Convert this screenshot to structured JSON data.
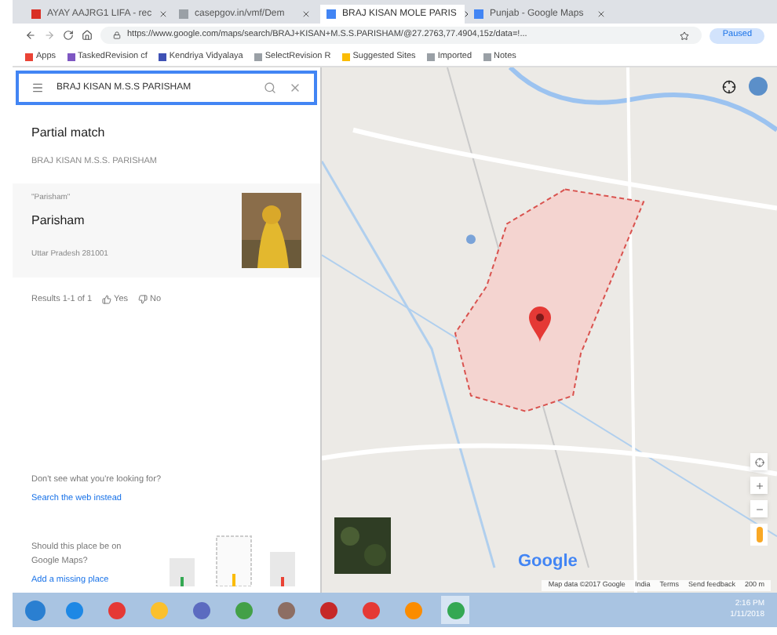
{
  "browser": {
    "tabs": [
      {
        "label": "AYAY AAJRG1 LIFA - rec",
        "selected": false,
        "color": "#d93025"
      },
      {
        "label": "casepgov.in/vmf/Dem",
        "selected": false,
        "color": "#9aa0a6"
      },
      {
        "label": "BRAJ KISAN MOLE PARIS",
        "selected": true,
        "color": "#4285f4"
      },
      {
        "label": "Punjab - Google Maps",
        "selected": false,
        "color": "#4285f4"
      }
    ],
    "url": "https://www.google.com/maps/search/BRAJ+KISAN+M.S.S.PARISHAM/@27.2763,77.4904,15z/data=!...",
    "profile": "Paused",
    "bookmarks": [
      {
        "label": "Apps",
        "color": "#ea4335"
      },
      {
        "label": "TaskedRevision cf",
        "color": "#7e57c2"
      },
      {
        "label": "Kendriya Vidyalaya",
        "color": "#3f51b5"
      },
      {
        "label": "SelectRevision R",
        "color": "#9aa0a6"
      },
      {
        "label": "Suggested Sites",
        "color": "#fbbc04"
      },
      {
        "label": "Imported",
        "color": "#9aa0a6"
      },
      {
        "label": "Notes",
        "color": "#9aa0a6"
      }
    ]
  },
  "panel": {
    "search": {
      "value": "BRAJ KISAN M.S.S PARISHAM"
    },
    "match_title": "Partial match",
    "match_subtitle": "BRAJ KISAN M.S.S. PARISHAM",
    "result": {
      "tag": "\"Parisham\"",
      "name": "Parisham",
      "address": "Uttar Pradesh 281001"
    },
    "feedback": {
      "label": "Results 1-1 of 1",
      "yes": "Yes",
      "no": "No"
    },
    "missing_prompt": "Don't see what you're looking for?",
    "missing_link": "Search the web instead",
    "add_prompt": "Should this place be on Google Maps?",
    "add_link": "Add a missing place"
  },
  "map": {
    "logo": "Google",
    "attribution": [
      "Map data ©2017 Google",
      "India",
      "Terms",
      "Send feedback",
      "200 m"
    ]
  },
  "taskbar": {
    "apps": [
      {
        "color": "#1e88e5",
        "selected": false
      },
      {
        "color": "#e53935",
        "selected": false
      },
      {
        "color": "#fbc02d",
        "selected": false
      },
      {
        "color": "#5c6bc0",
        "selected": false
      },
      {
        "color": "#43a047",
        "selected": false
      },
      {
        "color": "#8d6e63",
        "selected": false
      },
      {
        "color": "#c62828",
        "selected": false
      },
      {
        "color": "#e53935",
        "selected": false
      },
      {
        "color": "#fb8c00",
        "selected": false
      },
      {
        "color": "#34a853",
        "selected": true
      }
    ],
    "time": "2:16 PM",
    "date": "1/11/2018"
  }
}
